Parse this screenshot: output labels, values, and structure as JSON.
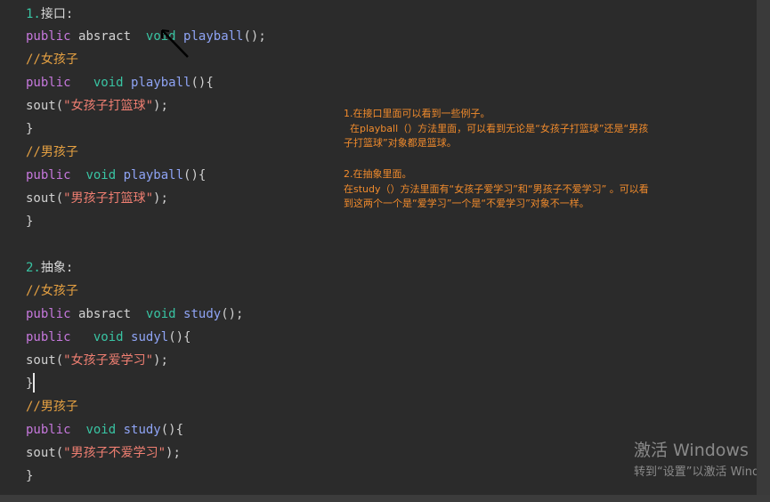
{
  "code": {
    "l1_heading_num": "1.",
    "l1_heading_text": "接口:",
    "l2": {
      "public": "public",
      "mod": "absract",
      "type": "void",
      "fn": "playball",
      "rest": "();"
    },
    "l3_comment": "//女孩子",
    "l4": {
      "public": "public",
      "type": "void",
      "fn": "playball",
      "rest": "(){"
    },
    "l5": {
      "call": "sout(",
      "str": "\"女孩子打篮球\"",
      "rest": ");"
    },
    "l6": "}",
    "l7_comment": "//男孩子",
    "l8": {
      "public": "public",
      "type": "void",
      "fn": "playball",
      "rest": "(){"
    },
    "l9": {
      "call": "sout(",
      "str": "\"男孩子打篮球\"",
      "rest": ");"
    },
    "l10": "}",
    "l11_heading_num": "2.",
    "l11_heading_text": "抽象:",
    "l12_comment": "//女孩子",
    "l13": {
      "public": "public",
      "mod": "absract",
      "type": "void",
      "fn": "study",
      "rest": "();"
    },
    "l14": {
      "public": "public",
      "type": "void",
      "fn": "sudyl",
      "rest": "(){"
    },
    "l15": {
      "call": "sout(",
      "str": "\"女孩子爱学习\"",
      "rest": ");"
    },
    "l16": "}",
    "l17_comment": "//男孩子",
    "l18": {
      "public": "public",
      "type": "void",
      "fn": "study",
      "rest": "(){"
    },
    "l19": {
      "call": "sout(",
      "str": "\"男孩子不爱学习\"",
      "rest": ");"
    },
    "l20": "}"
  },
  "notes": {
    "note1": "1.在接口里面可以看到一些例子。\n  在playball（）方法里面，可以看到无论是“女孩子打篮球”还是“男孩子打篮球”对象都是篮球。",
    "note2": "2.在抽象里面。\n在study（）方法里面有“女孩子爱学习”和“男孩子不爱学习” 。可以看到这两个一个是“爱学习”一个是“不爱学习”对象不一样。"
  },
  "watermark": {
    "title": "激活 Windows",
    "subtitle": "转到“设置”以激活 Windows。"
  },
  "icons": {
    "cursor": "arrow-cursor-icon"
  },
  "colors": {
    "background": "#2b2b2b",
    "keyword": "#c678dd",
    "type": "#39c4a3",
    "function": "#8fa4f5",
    "string": "#f07f72",
    "comment": "#e6a142",
    "note": "#f18b2c"
  }
}
